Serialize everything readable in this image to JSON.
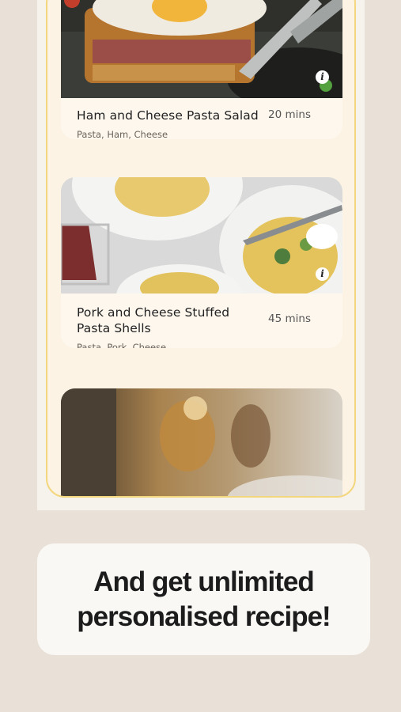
{
  "recipes": [
    {
      "title": "Ham and Cheese Pasta Salad",
      "time": "20 mins",
      "tags": "Pasta, Ham, Cheese",
      "image": "fried-egg-sandwich-photo"
    },
    {
      "title": "Pork and Cheese Stuffed Pasta Shells",
      "time": "45 mins",
      "tags": "Pasta, Pork, Cheese",
      "image": "spaghetti-plates-photo"
    },
    {
      "image": "blurred-bottle-photo"
    }
  ],
  "info_icon_glyph": "i",
  "banner": {
    "line1": "And get unlimited",
    "line2": "personalised recipe!"
  },
  "colors": {
    "background": "#e9e1d7",
    "panel": "#fcf3e4",
    "panel_border": "#f3d77e",
    "banner": "#faf8f4"
  }
}
